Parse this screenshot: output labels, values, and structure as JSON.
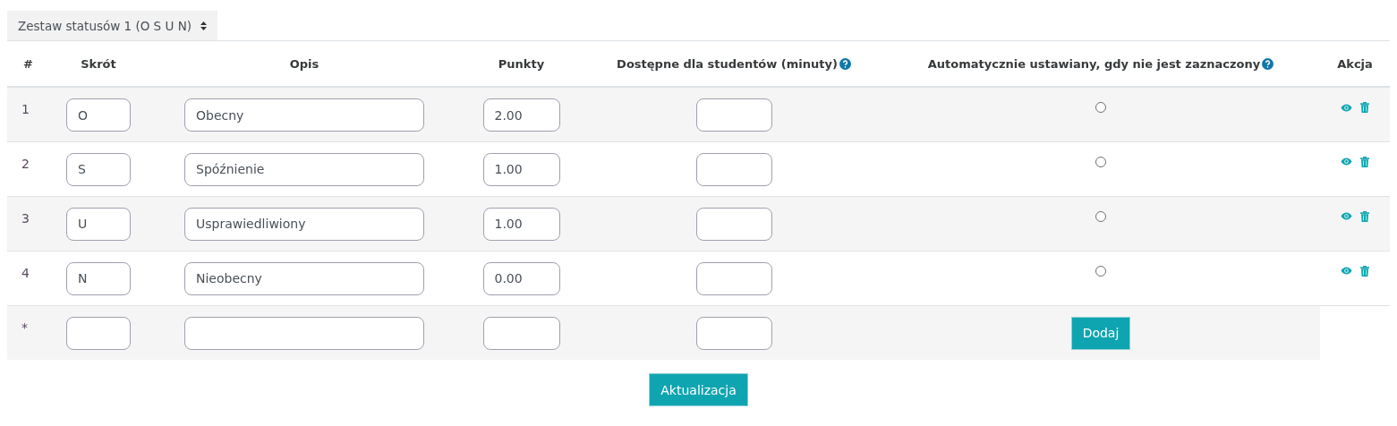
{
  "status_set": {
    "value": "Zestaw statusów 1 (O S U N)"
  },
  "table": {
    "columns": [
      {
        "label": "#",
        "help": false
      },
      {
        "label": "Skrót",
        "help": false
      },
      {
        "label": "Opis",
        "help": false
      },
      {
        "label": "Punkty",
        "help": false
      },
      {
        "label": "Dostępne dla studentów (minuty)",
        "help": true
      },
      {
        "label": "Automatycznie ustawiany, gdy nie jest zaznaczony",
        "help": true
      },
      {
        "label": "Akcja",
        "help": false
      }
    ],
    "rows": [
      {
        "number": "1",
        "acronym": "O",
        "description": "Obecny",
        "points": "2.00",
        "selected": false
      },
      {
        "number": "2",
        "acronym": "S",
        "description": "Spóźnienie",
        "points": "1.00",
        "selected": false
      },
      {
        "number": "3",
        "acronym": "U",
        "description": "Usprawiedliwiony",
        "points": "1.00",
        "selected": false
      },
      {
        "number": "4",
        "acronym": "N",
        "description": "Nieobecny",
        "points": "0.00",
        "selected": false
      }
    ],
    "new_row": {
      "number": "*",
      "add_button": "Dodaj"
    }
  },
  "update_button": "Aktualizacja"
}
